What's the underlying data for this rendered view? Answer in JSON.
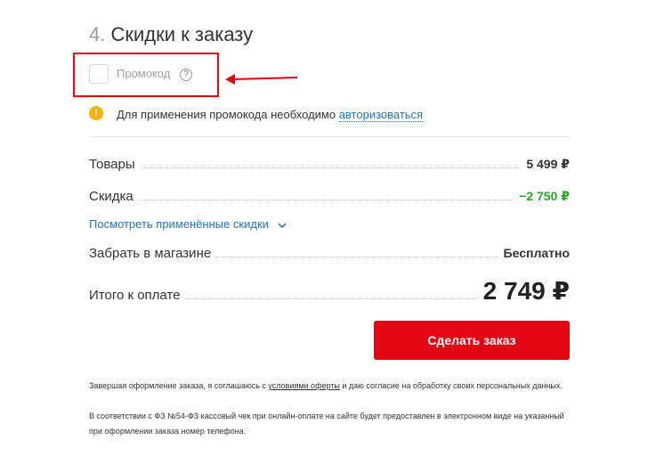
{
  "section": {
    "number": "4.",
    "title": "Скидки к заказу"
  },
  "promo": {
    "label": "Промокод",
    "help_icon": "question-circle-icon"
  },
  "auth_notice": {
    "icon": "info-icon",
    "text": "Для применения промокода необходимо ",
    "link": "авторизоваться"
  },
  "summary": {
    "goods_label": "Товары",
    "goods_value": "5 499 ₽",
    "discount_label": "Скидка",
    "discount_value": "−2 750 ₽",
    "view_discounts_link": "Посмотреть применённые скидки",
    "pickup_label": "Забрать в магазине",
    "pickup_value": "Бесплатно",
    "total_label": "Итого к оплате",
    "total_value": "2 749 ₽"
  },
  "order_button": {
    "label": "Сделать заказ"
  },
  "legal": {
    "line1_prefix": "Завершая оформление заказа, я соглашаюсь с ",
    "line1_link": "условиями оферты",
    "line1_suffix": " и даю согласие на обработку своих персональных данных.",
    "line2": "В соответствии с ФЗ №54-ФЗ кассовый чек при онлайн-оплате на сайте будет предоставлен в электронном виде на указанный при оформлении заказа номер телефона."
  },
  "colors": {
    "accent": "#e30613",
    "link": "#1d76c9",
    "discount": "#2aa52a",
    "info": "#f4b400"
  }
}
